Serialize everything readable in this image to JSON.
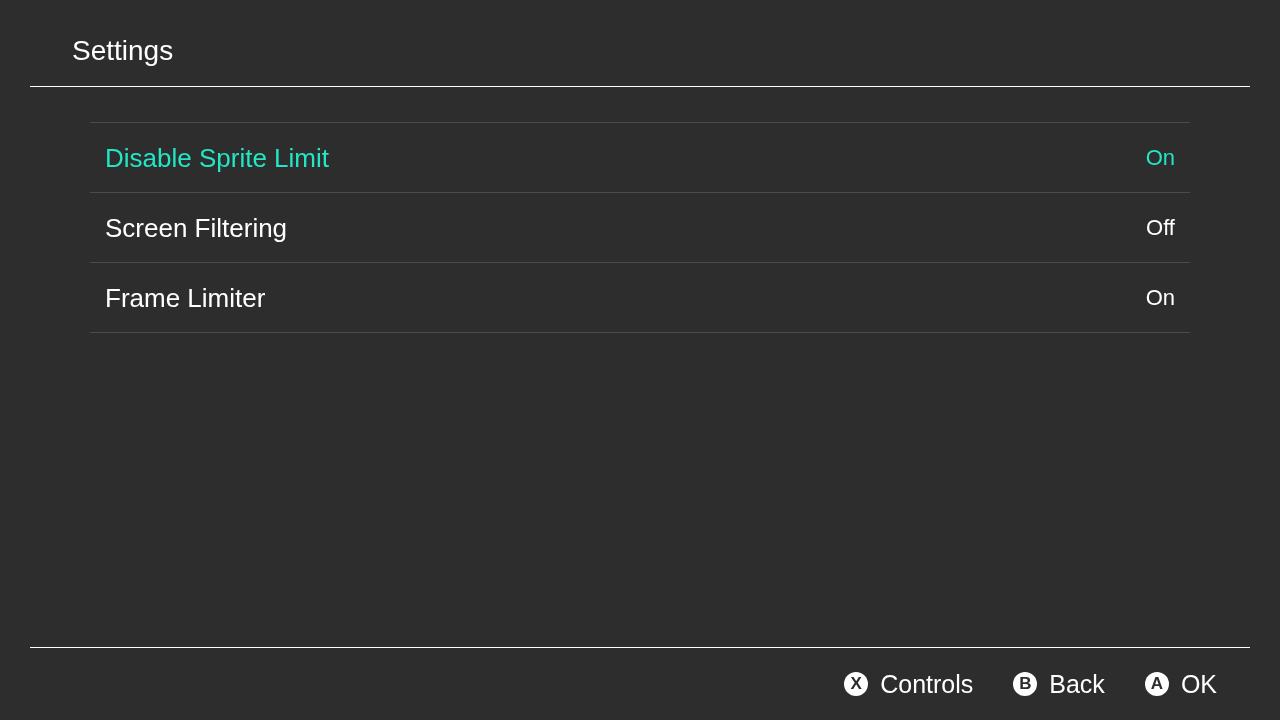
{
  "header": {
    "title": "Settings"
  },
  "settings": [
    {
      "label": "Disable Sprite Limit",
      "value": "On",
      "selected": true
    },
    {
      "label": "Screen Filtering",
      "value": "Off",
      "selected": false
    },
    {
      "label": "Frame Limiter",
      "value": "On",
      "selected": false
    }
  ],
  "footer": {
    "hints": [
      {
        "key": "X",
        "label": "Controls"
      },
      {
        "key": "B",
        "label": "Back"
      },
      {
        "key": "A",
        "label": "OK"
      }
    ]
  }
}
